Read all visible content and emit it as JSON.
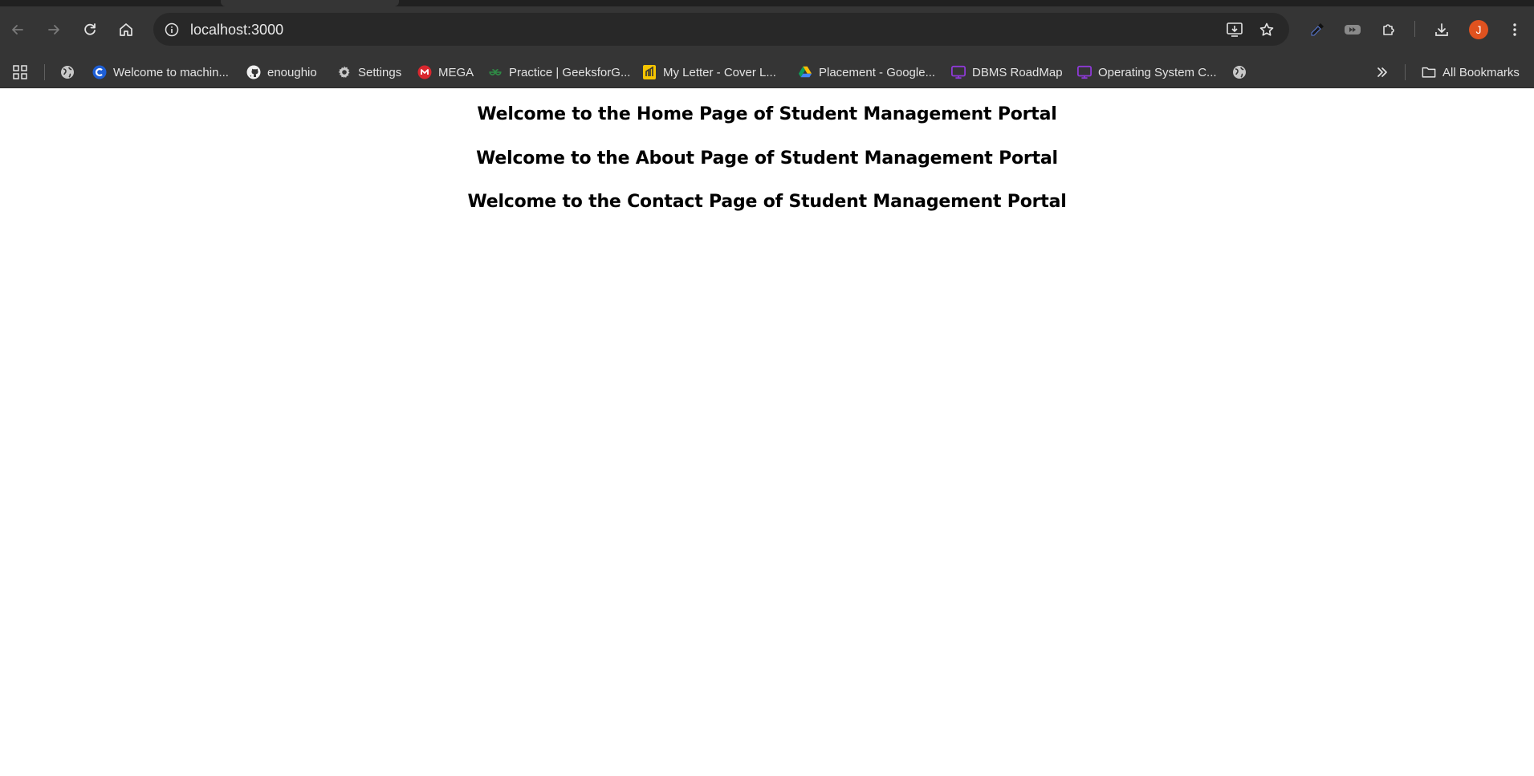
{
  "browser": {
    "url": "localhost:3000",
    "profile_initial": "J",
    "colors": {
      "frame": "#353535",
      "omnibox": "#282828",
      "avatar": "#e0521f"
    }
  },
  "bookmarks": {
    "items": [
      {
        "label": "",
        "icon": "globe-icon"
      },
      {
        "label": "Welcome to machin...",
        "icon": "c-logo-icon"
      },
      {
        "label": "enoughio",
        "icon": "github-icon"
      },
      {
        "label": "Settings",
        "icon": "gear-icon"
      },
      {
        "label": "MEGA",
        "icon": "mega-icon"
      },
      {
        "label": "Practice | GeeksforG...",
        "icon": "gfg-icon"
      },
      {
        "label": "My Letter - Cover L...",
        "icon": "doc-yellow-icon"
      },
      {
        "label": "Placement - Google...",
        "icon": "drive-icon"
      },
      {
        "label": "DBMS RoadMap",
        "icon": "purple-screen-icon"
      },
      {
        "label": "Operating System C...",
        "icon": "purple-screen-icon"
      },
      {
        "label": "",
        "icon": "globe-icon"
      }
    ],
    "all_bookmarks_label": "All Bookmarks"
  },
  "page": {
    "headings": [
      "Welcome to the Home Page of Student Management Portal",
      "Welcome to the About Page of Student Management Portal",
      "Welcome to the Contact Page of Student Management Portal"
    ]
  }
}
